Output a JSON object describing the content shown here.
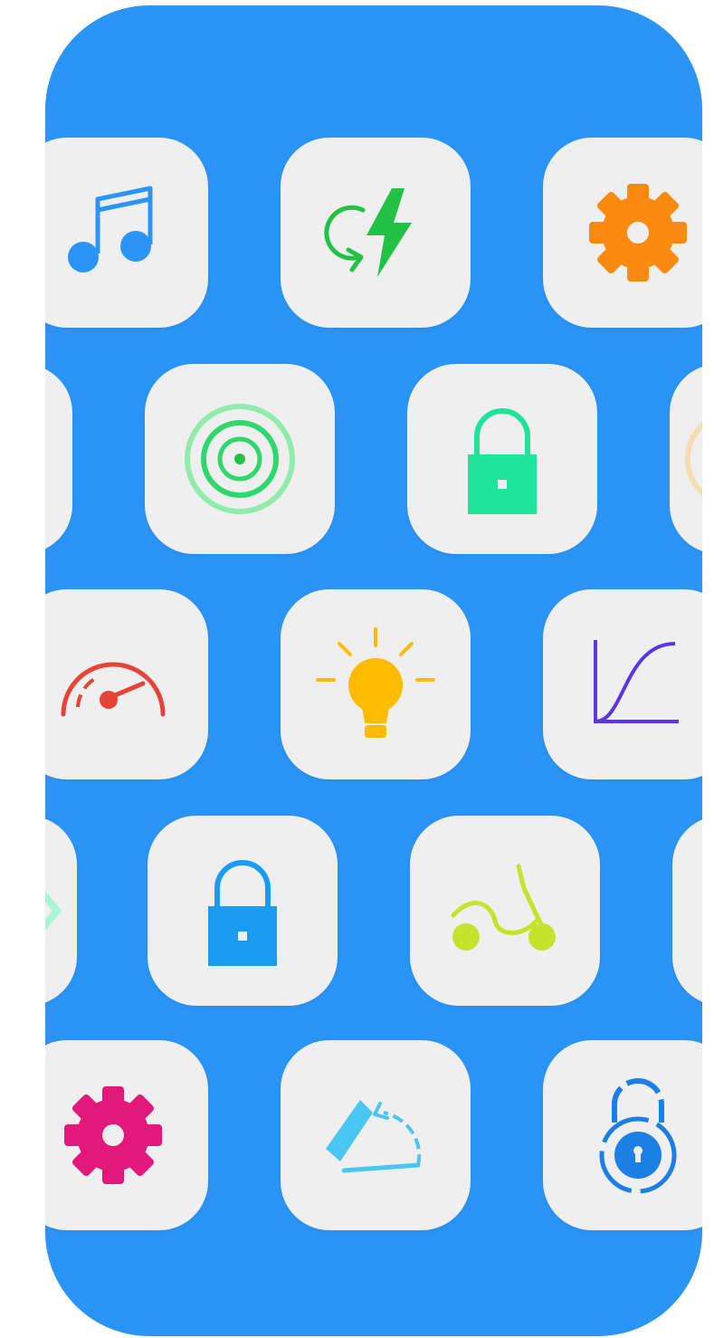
{
  "screen": {
    "title": "",
    "background_color": "#2b95f7",
    "tile_color": "#efefef"
  },
  "tiles": [
    {
      "row": 1,
      "icon": "music-note-icon",
      "color": "#2b95f7"
    },
    {
      "row": 1,
      "icon": "quick-charge-icon",
      "color": "#22c247"
    },
    {
      "row": 1,
      "icon": "gear-icon",
      "color": "#fb8a10"
    },
    {
      "row": 2,
      "icon": "partial-tile",
      "color": "#efefef"
    },
    {
      "row": 2,
      "icon": "radar-target-icon",
      "color": "#2fd86d"
    },
    {
      "row": 2,
      "icon": "padlock-icon",
      "color": "#1ee49a"
    },
    {
      "row": 2,
      "icon": "partial-tile",
      "color": "#f8d08a"
    },
    {
      "row": 3,
      "icon": "speedometer-icon",
      "color": "#e74336"
    },
    {
      "row": 3,
      "icon": "lightbulb-icon",
      "color": "#ffbb00"
    },
    {
      "row": 3,
      "icon": "curve-graph-icon",
      "color": "#5a36e8"
    },
    {
      "row": 4,
      "icon": "partial-tile",
      "color": "#a8f5d7"
    },
    {
      "row": 4,
      "icon": "padlock-icon",
      "color": "#1b9cf2"
    },
    {
      "row": 4,
      "icon": "scooter-icon",
      "color": "#c5e32a"
    },
    {
      "row": 4,
      "icon": "partial-tile",
      "color": "#efefef"
    },
    {
      "row": 5,
      "icon": "gear-icon",
      "color": "#e2197a"
    },
    {
      "row": 5,
      "icon": "kickstand-icon",
      "color": "#49c7f2"
    },
    {
      "row": 5,
      "icon": "combination-lock-icon",
      "color": "#1c7fe3"
    }
  ]
}
